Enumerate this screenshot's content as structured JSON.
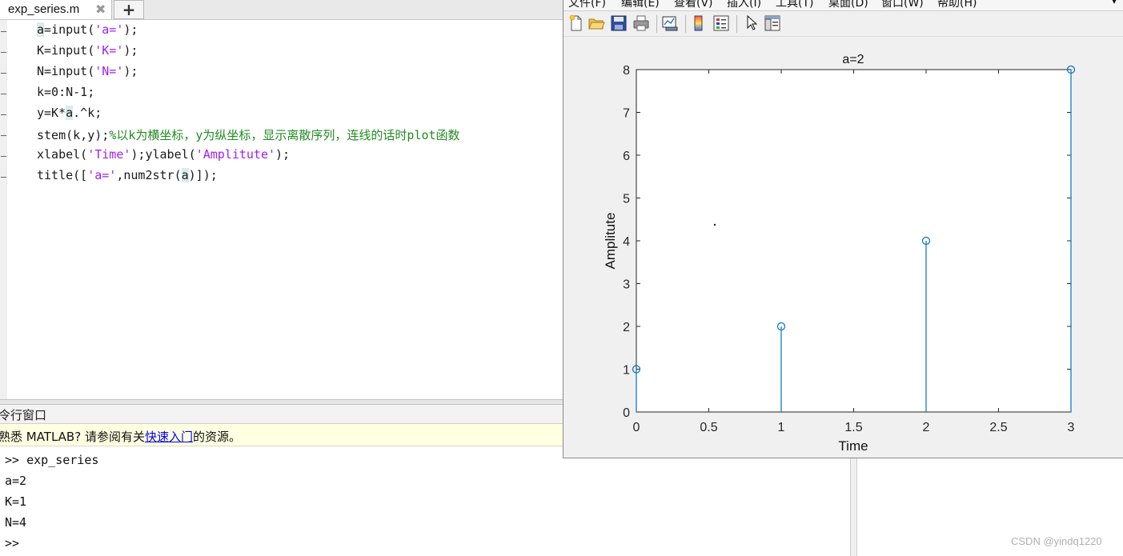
{
  "editor": {
    "tab_label": "exp_series.m",
    "tab_close": "✖",
    "tab_add": "+",
    "lines": [
      {
        "parts": [
          {
            "t": "a",
            "c": "hl"
          },
          {
            "t": "=input(",
            "c": ""
          },
          {
            "t": "'a='",
            "c": "str"
          },
          {
            "t": ");",
            "c": ""
          }
        ]
      },
      {
        "parts": [
          {
            "t": "K=input(",
            "c": ""
          },
          {
            "t": "'K='",
            "c": "str"
          },
          {
            "t": ");",
            "c": ""
          }
        ]
      },
      {
        "parts": [
          {
            "t": "N=input(",
            "c": ""
          },
          {
            "t": "'N='",
            "c": "str"
          },
          {
            "t": ");",
            "c": ""
          }
        ]
      },
      {
        "parts": [
          {
            "t": "k=0:N-1;",
            "c": ""
          }
        ]
      },
      {
        "parts": [
          {
            "t": "y=K*",
            "c": ""
          },
          {
            "t": "a",
            "c": "hl"
          },
          {
            "t": ".^k;",
            "c": ""
          }
        ]
      },
      {
        "parts": [
          {
            "t": "stem(k,y);",
            "c": ""
          },
          {
            "t": "%以k为横坐标，y为纵坐标，显示离散序列，连线的话时plot函数",
            "c": "cmt"
          }
        ]
      },
      {
        "parts": [
          {
            "t": "xlabel(",
            "c": ""
          },
          {
            "t": "'Time'",
            "c": "str"
          },
          {
            "t": ");ylabel(",
            "c": ""
          },
          {
            "t": "'Amplitute'",
            "c": "str"
          },
          {
            "t": ");",
            "c": ""
          }
        ]
      },
      {
        "parts": [
          {
            "t": "title([",
            "c": ""
          },
          {
            "t": "'a='",
            "c": "str"
          },
          {
            "t": ",num2str(",
            "c": ""
          },
          {
            "t": "a",
            "c": "hl"
          },
          {
            "t": ")]);",
            "c": ""
          }
        ]
      }
    ]
  },
  "command_window": {
    "title": "令行窗口",
    "banner_prefix": "熟悉 MATLAB? 请参阅有关",
    "banner_link": "快速入门",
    "banner_suffix": "的资源。",
    "lines": [
      ">> exp_series",
      "a=2",
      "K=1",
      "N=4",
      ">>"
    ]
  },
  "figure": {
    "menu": [
      "文件(F)",
      "编辑(E)",
      "查看(V)",
      "插入(I)",
      "工具(T)",
      "桌面(D)",
      "窗口(W)",
      "帮助(H)"
    ],
    "menu_end": "▾",
    "toolbar": [
      "new-figure-icon",
      "open-file-icon",
      "save-icon",
      "print-icon",
      "link-plot-icon",
      "colorbar-icon",
      "legend-icon",
      "pointer-icon",
      "property-editor-icon"
    ],
    "stem_color": "#0072bd"
  },
  "chart_data": {
    "type": "stem",
    "title": "a=2",
    "xlabel": "Time",
    "ylabel": "Amplitute",
    "x": [
      0,
      1,
      2,
      3
    ],
    "y": [
      1,
      2,
      4,
      8
    ],
    "xlim": [
      0,
      3
    ],
    "ylim": [
      0,
      8
    ],
    "xticks": [
      "0",
      "0.5",
      "1",
      "1.5",
      "2",
      "2.5",
      "3"
    ],
    "yticks": [
      "0",
      "1",
      "2",
      "3",
      "4",
      "5",
      "6",
      "7",
      "8"
    ],
    "grid": false,
    "marker": "circle"
  },
  "watermark": "CSDN @yindq1220"
}
